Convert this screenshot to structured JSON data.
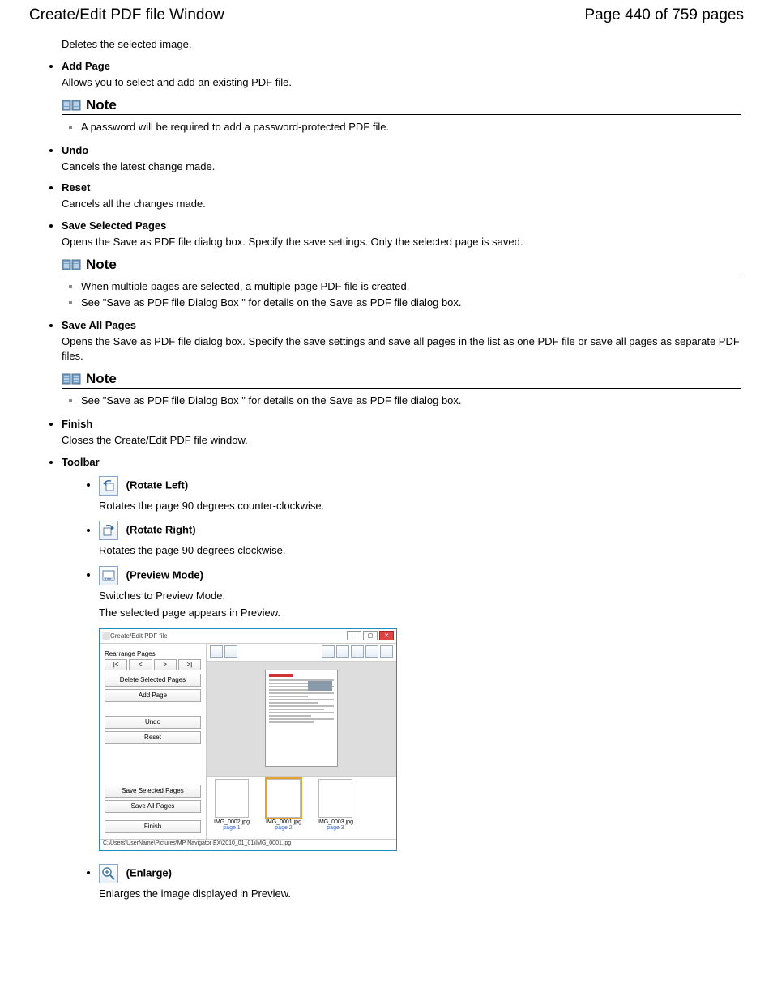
{
  "header": {
    "title": "Create/Edit PDF file Window",
    "page_label": "Page 440 of 759 pages"
  },
  "delete_selected_image_desc": "Deletes the selected image.",
  "items": {
    "add_page": {
      "title": "Add Page",
      "desc": "Allows you to select and add an existing PDF file."
    },
    "undo": {
      "title": "Undo",
      "desc": "Cancels the latest change made."
    },
    "reset": {
      "title": "Reset",
      "desc": "Cancels all the changes made."
    },
    "save_selected": {
      "title": "Save Selected Pages",
      "desc": "Opens the Save as PDF file dialog box. Specify the save settings. Only the selected page is saved."
    },
    "save_all": {
      "title": "Save All Pages",
      "desc": "Opens the Save as PDF file dialog box. Specify the save settings and save all pages in the list as one PDF file or save all pages as separate PDF files."
    },
    "finish": {
      "title": "Finish",
      "desc": "Closes the Create/Edit PDF file window."
    },
    "toolbar": {
      "title": "Toolbar"
    },
    "rotate_left": {
      "title": " (Rotate Left)",
      "desc": "Rotates the page 90 degrees counter-clockwise."
    },
    "rotate_right": {
      "title": " (Rotate Right)",
      "desc": "Rotates the page 90 degrees clockwise."
    },
    "preview_mode": {
      "title": " (Preview Mode)",
      "desc1": "Switches to Preview Mode.",
      "desc2": "The selected page appears in Preview."
    },
    "enlarge": {
      "title": " (Enlarge)",
      "desc": "Enlarges the image displayed in Preview."
    }
  },
  "notes": {
    "label": "Note",
    "n1": {
      "text": "A password will be required to add a password-protected PDF file."
    },
    "n2": {
      "text1": "When multiple pages are selected, a multiple-page PDF file is created.",
      "see_pre": "See \"",
      "link": "Save as PDF file Dialog Box",
      "see_post": " \" for details on the Save as PDF file dialog box."
    },
    "n3": {
      "see_pre": "See \"",
      "link": "Save as PDF file Dialog Box",
      "see_post": " \" for details on the Save as PDF file dialog box."
    }
  },
  "screenshot": {
    "window_title": "Create/Edit PDF file",
    "sidebar": {
      "rearrange": "Rearrange Pages",
      "nav": {
        "first": "|<",
        "prev": "<",
        "next": ">",
        "last": ">|"
      },
      "delete_selected": "Delete Selected Pages",
      "add_page": "Add Page",
      "undo": "Undo",
      "reset": "Reset",
      "save_selected": "Save Selected Pages",
      "save_all": "Save All Pages",
      "finish": "Finish"
    },
    "thumbs": [
      {
        "name": "IMG_0002.jpg",
        "page": "page 1"
      },
      {
        "name": "IMG_0001.jpg",
        "page": "page 2"
      },
      {
        "name": "IMG_0003.jpg",
        "page": "page 3"
      }
    ],
    "status": "C:\\Users\\UserName\\Pictures\\MP Navigator EX\\2010_01_01\\IMG_0001.jpg"
  }
}
